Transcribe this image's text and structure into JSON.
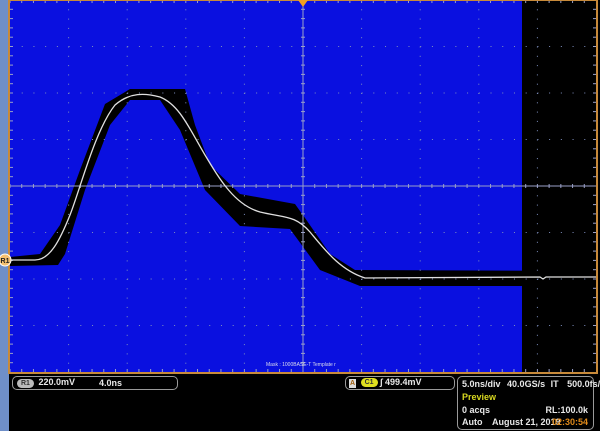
{
  "screen": {
    "mask_label": "Mask : 1000BASE-T Template r",
    "ref_marker": "R1",
    "colors": {
      "graticule_bg": "#0a10e0",
      "mask": "#000000",
      "trace": "#e0e0e0",
      "border": "#c88a3a",
      "time_text": "#e08a1a",
      "preview_text": "#d8d820"
    }
  },
  "ref_readout": {
    "badge": "R1",
    "scale": "220.0mV",
    "time": "4.0ns"
  },
  "trigger_readout": {
    "mode_icon": "A",
    "source": "C1",
    "slope_icon": "rising-edge-icon",
    "slope": "∫",
    "level": "499.4mV"
  },
  "acq_readout": {
    "timebase": "5.0ns/div",
    "sample_rate": "40.0GS/s",
    "mode": "IT",
    "resolution": "500.0fs/pt",
    "state": "Preview",
    "acqs": "0 acqs",
    "record_length": "RL:100.0k",
    "trigger_mode": "Auto",
    "date": "August 21, 2019",
    "time": "02:30:54"
  }
}
